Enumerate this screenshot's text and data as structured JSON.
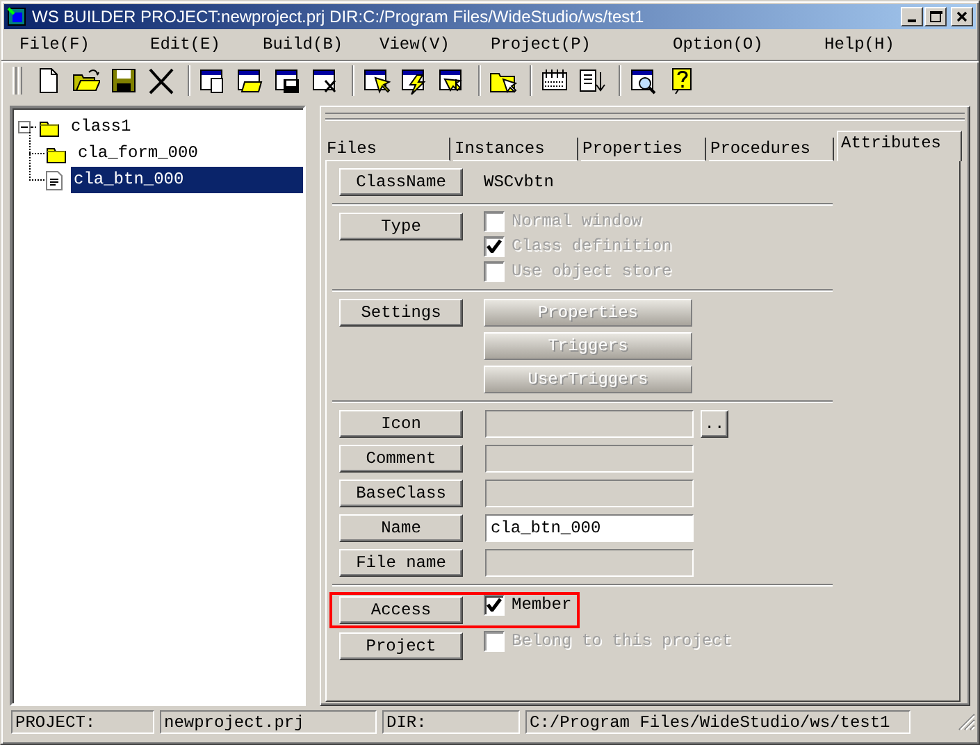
{
  "window": {
    "title": "WS BUILDER PROJECT:newproject.prj DIR:C:/Program Files/WideStudio/ws/test1"
  },
  "menu": [
    "File(F)",
    "Edit(E)",
    "Build(B)",
    "View(V)",
    "Project(P)",
    "Option(O)",
    "Help(H)"
  ],
  "tree": [
    {
      "label": "class1",
      "kind": "folder",
      "expanded": true,
      "selected": false,
      "children": [
        {
          "label": "cla_form_000",
          "kind": "folder",
          "selected": false
        },
        {
          "label": "cla_btn_000",
          "kind": "file",
          "selected": true
        }
      ]
    }
  ],
  "tabs": [
    {
      "label": "Files",
      "selected": false
    },
    {
      "label": "Instances",
      "selected": false
    },
    {
      "label": "Properties",
      "selected": false
    },
    {
      "label": "Procedures",
      "selected": false
    },
    {
      "label": "Attributes",
      "selected": true
    }
  ],
  "attributes": [
    [
      {
        "kind": "text",
        "label": "ClassName",
        "value": "WSCvbtn"
      }
    ],
    [
      {
        "kind": "checks",
        "label": "Type",
        "options": [
          {
            "label": "Normal window",
            "checked": false,
            "disabled": true
          },
          {
            "label": "Class definition",
            "checked": true,
            "disabled": true
          },
          {
            "label": "Use object store",
            "checked": false,
            "disabled": true
          }
        ]
      }
    ],
    [
      {
        "kind": "buttons",
        "label": "Settings",
        "buttons": [
          {
            "label": "Properties",
            "disabled": true
          },
          {
            "label": "Triggers",
            "disabled": true
          },
          {
            "label": "UserTriggers",
            "disabled": true
          }
        ]
      }
    ],
    [
      {
        "kind": "field",
        "label": "Icon",
        "disabled": true,
        "browse": ".."
      },
      {
        "kind": "field",
        "label": "Comment",
        "disabled": true
      },
      {
        "kind": "field",
        "label": "BaseClass",
        "disabled": true
      },
      {
        "kind": "field",
        "label": "Name",
        "disabled": false,
        "value": "cla_btn_000"
      },
      {
        "kind": "field",
        "label": "File name",
        "disabled": true
      }
    ],
    [
      {
        "kind": "checks",
        "label": "Access",
        "highlighted": true,
        "options": [
          {
            "label": "Member",
            "checked": true,
            "disabled": false
          }
        ]
      },
      {
        "kind": "checks",
        "label": "Project",
        "highlighted": false,
        "options": [
          {
            "label": "Belong to this project",
            "checked": false,
            "disabled": true
          }
        ]
      }
    ]
  ],
  "status_bar": [
    "PROJECT:",
    "newproject.prj",
    "DIR:",
    "C:/Program Files/WideStudio/ws/test1"
  ]
}
